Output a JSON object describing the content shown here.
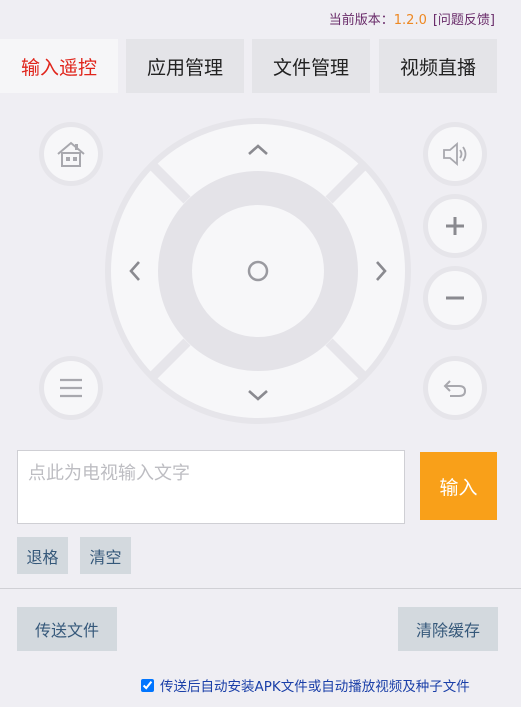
{
  "header": {
    "version_label": "当前版本：",
    "version": "1.2.0",
    "feedback": "[问题反馈]"
  },
  "tabs": [
    {
      "label": "输入遥控",
      "active": true
    },
    {
      "label": "应用管理",
      "active": false
    },
    {
      "label": "文件管理",
      "active": false
    },
    {
      "label": "视频直播",
      "active": false
    }
  ],
  "remote": {
    "icons": [
      "home-icon",
      "menu-icon",
      "volume-icon",
      "plus-icon",
      "minus-icon",
      "back-icon",
      "up-arrow-icon",
      "down-arrow-icon",
      "left-arrow-icon",
      "right-arrow-icon",
      "ok-icon"
    ]
  },
  "input": {
    "placeholder": "点此为电视输入文字",
    "value": "",
    "submit_label": "输入"
  },
  "actions": {
    "backspace": "退格",
    "clear": "清空",
    "send_file": "传送文件",
    "clear_cache": "清除缓存"
  },
  "auto_option": {
    "checked": true,
    "label": "传送后自动安装APK文件或自动播放视频及种子文件"
  },
  "colors": {
    "active_tab": "#e0241b",
    "accent": "#f9a019",
    "link": "#1a3fa8"
  }
}
